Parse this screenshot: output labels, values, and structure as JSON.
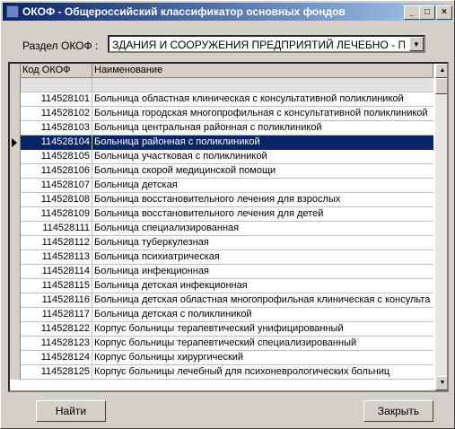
{
  "window": {
    "title": "ОКОФ - Общероссийский классификатор основных фондов",
    "minimize": "_",
    "maximize": "□",
    "close": "×"
  },
  "section": {
    "label": "Раздел ОКОФ :",
    "value": "ЗДАНИЯ И СООРУЖЕНИЯ ПРЕДПРИЯТИЙ ЛЕЧЕБНО - ПРОФ"
  },
  "grid": {
    "columns": [
      "Код ОКОФ",
      "Наименование"
    ],
    "selected_index": 3,
    "rows": [
      {
        "code": "114528101",
        "name": "Больница областная клиническая с консультативной поликлиникой"
      },
      {
        "code": "114528102",
        "name": "Больница городская многопрофильная с консультативной поликлиникой"
      },
      {
        "code": "114528103",
        "name": "Больница центральная районная с поликлиникой"
      },
      {
        "code": "114528104",
        "name": "Больница районная с поликлиникой"
      },
      {
        "code": "114528105",
        "name": "Больница участковая с поликлиникой"
      },
      {
        "code": "114528106",
        "name": "Больница скорой медицинской помощи"
      },
      {
        "code": "114528107",
        "name": "Больница детская"
      },
      {
        "code": "114528108",
        "name": "Больница восстановительного лечения для взрослых"
      },
      {
        "code": "114528109",
        "name": "Больница восстановительного лечения для детей"
      },
      {
        "code": "114528111",
        "name": "Больница специализированная"
      },
      {
        "code": "114528112",
        "name": "Больница туберкулезная"
      },
      {
        "code": "114528113",
        "name": "Больница психиатрическая"
      },
      {
        "code": "114528114",
        "name": "Больница инфекционная"
      },
      {
        "code": "114528115",
        "name": "Больница детская инфекционная"
      },
      {
        "code": "114528116",
        "name": "Больница детская областная многопрофильная клиническая с консульта"
      },
      {
        "code": "114528117",
        "name": "Больница детская с поликлиникой"
      },
      {
        "code": "114528122",
        "name": "Корпус больницы терапевтический унифицированный"
      },
      {
        "code": "114528123",
        "name": "Корпус больницы терапевтический специализированный"
      },
      {
        "code": "114528124",
        "name": "Корпус больницы хирургический"
      },
      {
        "code": "114528125",
        "name": "Корпус больницы лечебный для психоневрологических больниц"
      }
    ]
  },
  "buttons": {
    "find": "Найти",
    "close": "Закрыть"
  }
}
